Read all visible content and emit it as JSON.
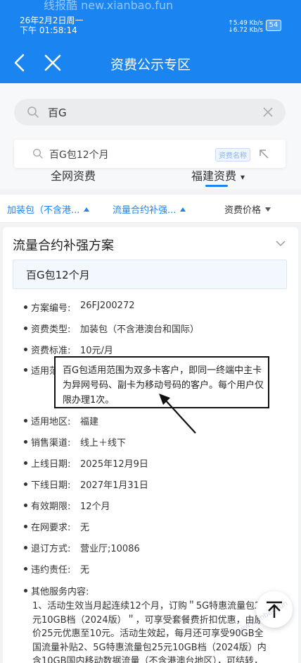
{
  "status_bar": {
    "watermark": "线报酷 new.xianbao.fun",
    "date": "26年2月2日周一",
    "time": "下午 01:58:14",
    "net_up": "↑5.49 Kb/s",
    "net_down": "↓6.72 Kb/s",
    "battery": "54"
  },
  "nav": {
    "title": "资费公示专区",
    "back_icon": "chevron-left-icon",
    "close_icon": "close-icon"
  },
  "search": {
    "value": "百G",
    "suggestion": "百G包12个月",
    "suggestion_tag": "资费名称"
  },
  "regions": {
    "national": "全网资费",
    "local": "福建资费",
    "local_caret": "▾"
  },
  "filters": {
    "package_type": "加装包（不含港...",
    "category": "流量合约补强...",
    "price": "资费价格"
  },
  "section": {
    "title": "流量合约补强方案",
    "plan_name": "百G包12个月"
  },
  "details": {
    "code_label": "方案编号:",
    "code": "26FJ200272",
    "type_label": "资费类型:",
    "type": "加装包（不含港澳台和国际）",
    "price_label": "资费标准:",
    "price": "10元/月",
    "scope_label": "适用范围:",
    "scope": "百G包适用范围为双多卡客户，即同一终端中主卡为异网号码、副卡为移动号码的客户。每个用户仅限办理1次。",
    "area_label": "适用地区:",
    "area": "福建",
    "channel_label": "销售渠道:",
    "channel": "线上＋线下",
    "online_label": "上线日期:",
    "online": "2025年12月9日",
    "offline_label": "下线日期:",
    "offline": "2027年1月31日",
    "validity_label": "有效期限:",
    "validity": "12个月",
    "tenure_label": "在网要求:",
    "tenure": "无",
    "unsubscribe_label": "退订方式:",
    "unsubscribe": "营业厅;10086",
    "penalty_label": "违约责任:",
    "penalty": "无",
    "other_label": "其他服务内容:",
    "other": "1、活动生效当月起连续12个月，订购＂5G特惠流量包25元10GB档（2024版）＂，可享受套餐费折扣优惠，由原价25元优惠至10元。活动生效起，每月还可享受90GB全国流量补贴2、5G特惠流量包25元10GB档（2024版）内含10GB国内移动数据流量（不含港澳台地区），可结转，不能与他"
  },
  "float_button": "back-to-top-icon",
  "watermark2": "new.xianbao.fun"
}
